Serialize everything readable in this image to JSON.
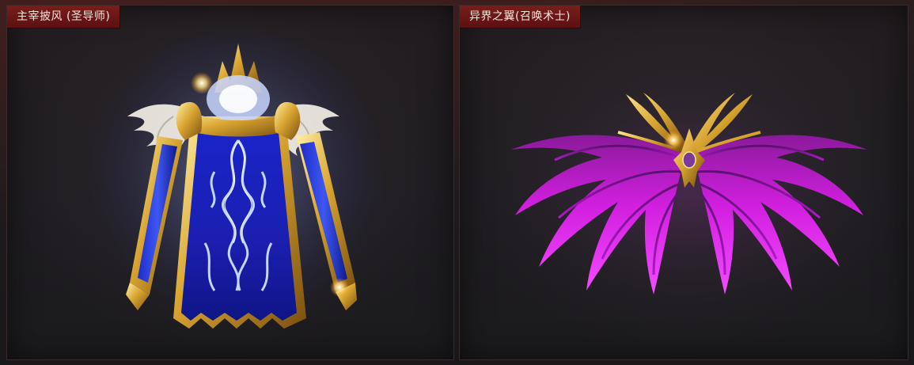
{
  "items": [
    {
      "title": "主宰披风 (圣导师)",
      "icon": "blue-gold-cape-icon"
    },
    {
      "title": "异界之翼(召唤术士)",
      "icon": "purple-feather-wings-icon"
    }
  ],
  "colors": {
    "label_bg": "#6a1614",
    "label_text": "#f2e7d6",
    "cape_blue": "#1d2bd8",
    "cape_glow": "#cfe0ff",
    "gold": "#d9a531",
    "wing_purple": "#d21fe0"
  }
}
